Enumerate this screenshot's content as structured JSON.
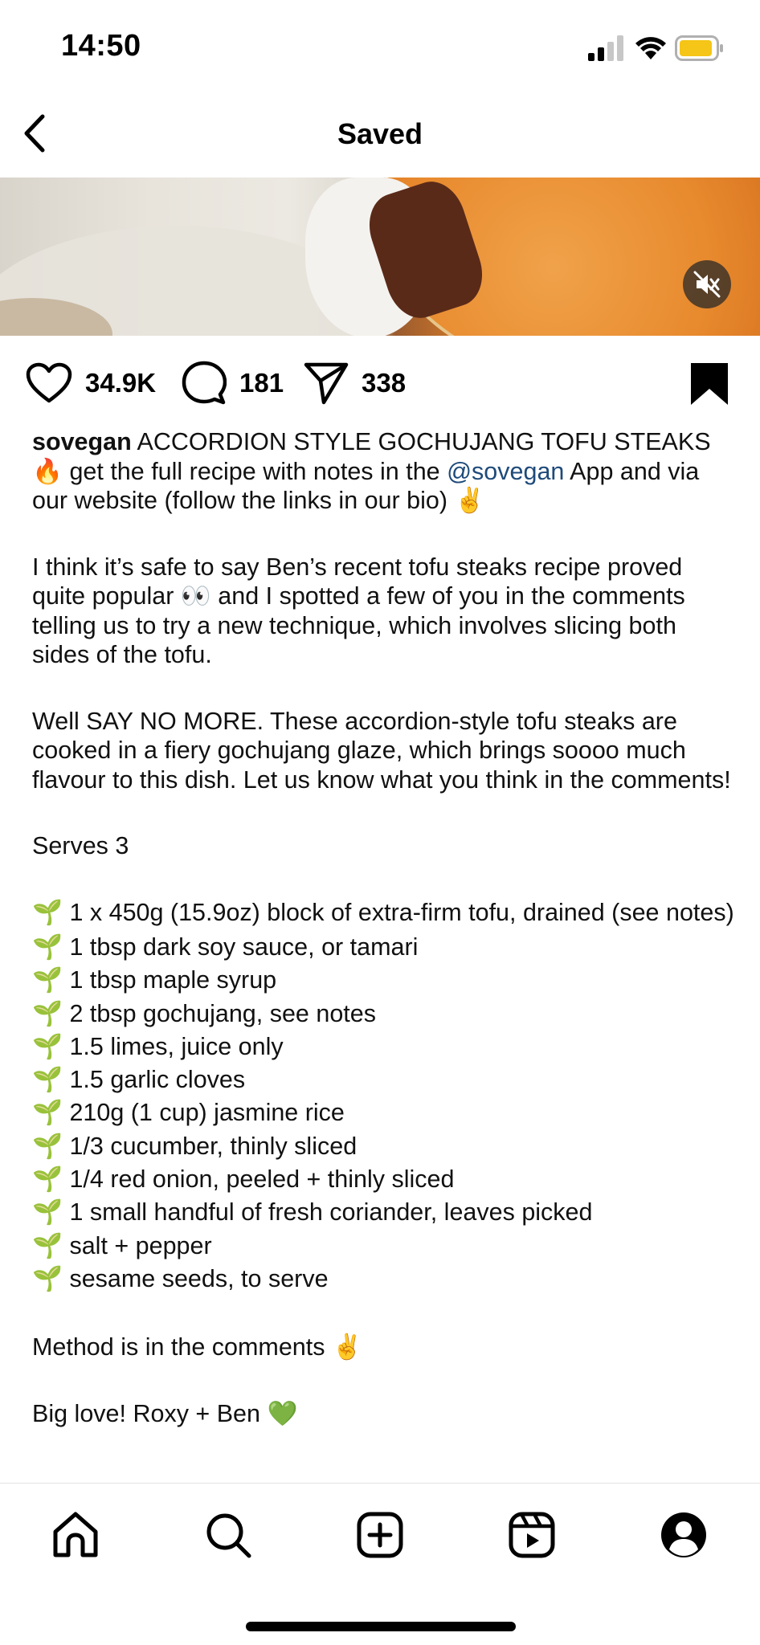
{
  "status_bar": {
    "time": "14:50",
    "icons": [
      "signal-icon",
      "wifi-icon",
      "battery-icon"
    ],
    "battery_color": "#f5c518"
  },
  "header": {
    "title": "Saved",
    "back_icon": "chevron-left-icon"
  },
  "media": {
    "mute_icon": "speaker-muted-icon"
  },
  "actions": {
    "likes": "34.9K",
    "comments": "181",
    "shares": "338",
    "bookmarked": true
  },
  "caption": {
    "username": "sovegan",
    "intro_a": " ACCORDION STYLE GOCHUJANG TOFU STEAKS 🔥 get the full recipe with notes in the ",
    "mention": "@sovegan",
    "intro_b": " App and via our website (follow the links in our bio) ✌️",
    "para1": "I think it’s safe to say Ben’s recent tofu steaks recipe proved quite popular 👀 and I spotted a few of you in the comments telling us to try a new technique, which involves slicing both sides of the tofu.",
    "para2": "Well SAY NO MORE. These accordion-style tofu steaks are cooked in a fiery gochujang glaze, which brings soooo much flavour to this dish. Let us know what you think in the comments!",
    "serves": "Serves 3",
    "ingredients": [
      "🌱 1 x 450g (15.9oz) block of extra-firm tofu, drained (see notes)",
      "🌱 1 tbsp dark soy sauce, or tamari",
      "🌱 1 tbsp maple syrup",
      "🌱 2 tbsp gochujang, see notes",
      "🌱 1.5 limes, juice only",
      "🌱 1.5 garlic cloves",
      "🌱 210g (1 cup) jasmine rice",
      "🌱 1/3 cucumber, thinly sliced",
      "🌱 1/4 red onion, peeled + thinly sliced",
      "🌱 1 small handful of fresh coriander, leaves picked",
      "🌱 salt + pepper",
      "🌱 sesame seeds, to serve"
    ],
    "method": "Method is in the comments ✌️",
    "signoff": "Big love! Roxy + Ben 💚"
  },
  "bottom_nav": {
    "items": [
      "home-icon",
      "search-icon",
      "create-icon",
      "reels-icon",
      "profile-icon"
    ]
  }
}
